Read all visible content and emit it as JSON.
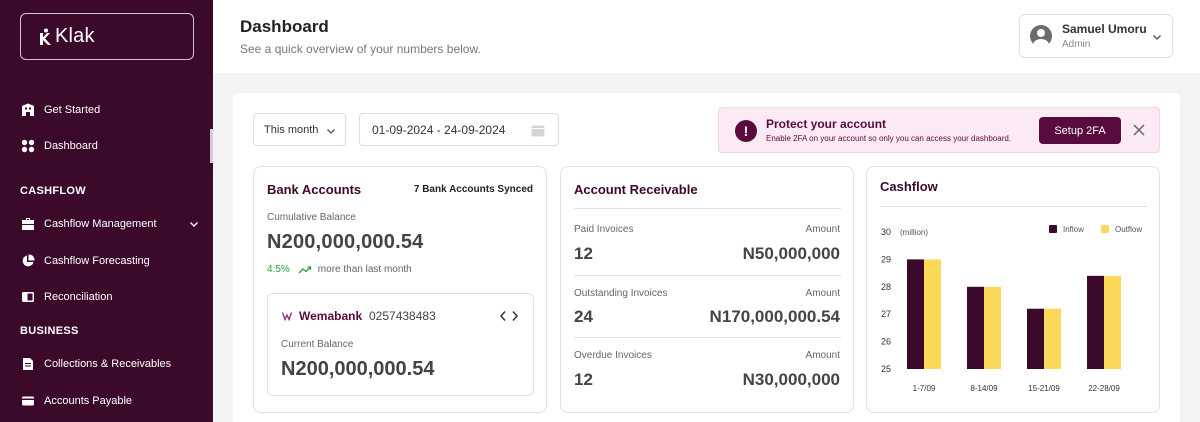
{
  "sidebar": {
    "logo": "Klak",
    "items": [
      {
        "label": "Get Started",
        "icon": "building-icon"
      },
      {
        "label": "Dashboard",
        "icon": "grid-icon"
      },
      {
        "label": "Cashflow Management",
        "icon": "briefcase-icon"
      },
      {
        "label": "Cashflow Forecasting",
        "icon": "pie-chart-icon"
      },
      {
        "label": "Reconciliation",
        "icon": "columns-icon"
      },
      {
        "label": "Collections & Receivables",
        "icon": "document-icon"
      },
      {
        "label": "Accounts Payable",
        "icon": "card-icon"
      }
    ],
    "sections": {
      "cashflow": "CASHFLOW",
      "business": "BUSINESS"
    }
  },
  "header": {
    "title": "Dashboard",
    "subtitle": "See a quick overview of your numbers below.",
    "user": {
      "name": "Samuel Umoru",
      "role": "Admin"
    }
  },
  "filters": {
    "period": "This month",
    "date_range": "01-09-2024 - 24-09-2024"
  },
  "alert": {
    "icon": "!",
    "title": "Protect your account",
    "text": "Enable 2FA on your account so only you can access your dashboard.",
    "button": "Setup 2FA"
  },
  "bank_accounts": {
    "title": "Bank Accounts",
    "synced": "7 Bank Accounts Synced",
    "cumulative_label": "Cumulative Balance",
    "cumulative_value": "N200,000,000.54",
    "growth_pct": "4.5%",
    "growth_text": "more than last month",
    "account": {
      "bank": "Wemabank",
      "number": "0257438483",
      "balance_label": "Current Balance",
      "balance": "N200,000,000.54"
    }
  },
  "receivable": {
    "title": "Account Receivable",
    "amount_label": "Amount",
    "rows": [
      {
        "label": "Paid Invoices",
        "count": "12",
        "amount": "N50,000,000"
      },
      {
        "label": "Outstanding Invoices",
        "count": "24",
        "amount": "N170,000,000.54"
      },
      {
        "label": "Overdue Invoices",
        "count": "12",
        "amount": "N30,000,000"
      }
    ]
  },
  "colors": {
    "brand": "#3b0a2a",
    "inflow": "#3b0a2a",
    "outflow": "#f9d85a",
    "growth": "#2e9b3e"
  },
  "chart_data": {
    "type": "bar",
    "title": "Cashflow",
    "ylabel": "(million)",
    "categories": [
      "1-7/09",
      "8-14/09",
      "15-21/09",
      "22-28/09"
    ],
    "series": [
      {
        "name": "Inflow",
        "values": [
          29.0,
          28.0,
          27.2,
          28.4
        ]
      },
      {
        "name": "Outflow",
        "values": [
          29.0,
          28.0,
          27.2,
          28.4
        ]
      }
    ],
    "yticks": [
      25,
      26,
      27,
      28,
      29,
      30
    ],
    "ylim": [
      25,
      30
    ],
    "legend": "top-right",
    "grid": false
  }
}
